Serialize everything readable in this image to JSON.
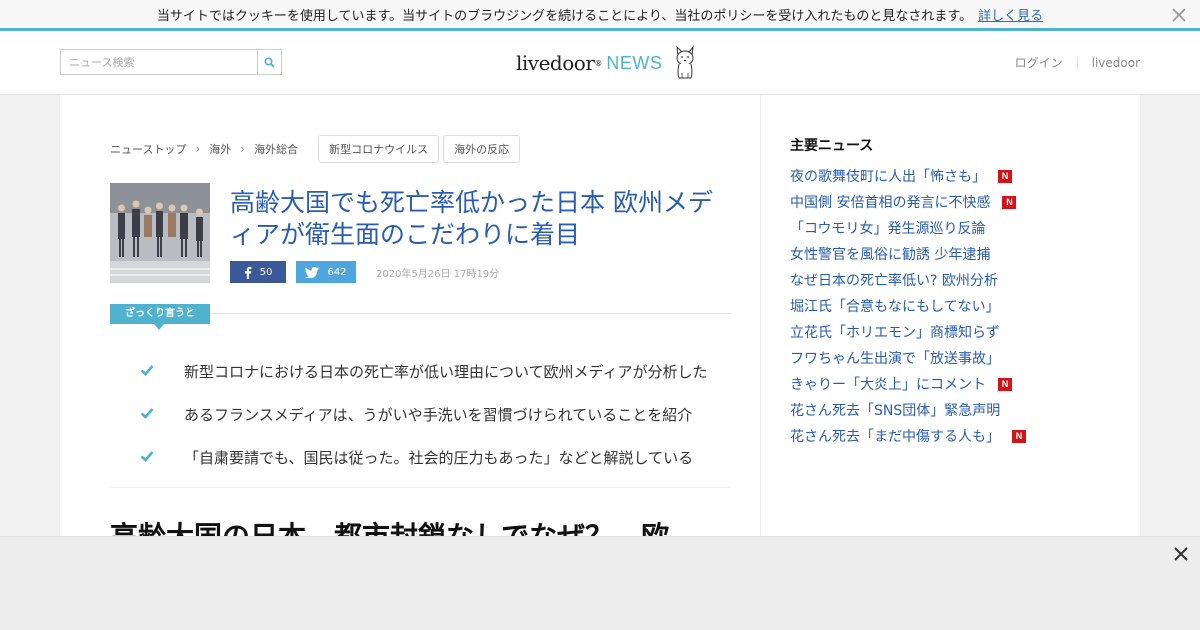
{
  "cookie_bar": {
    "message": "当サイトではクッキーを使用しています。当サイトのブラウジングを続けることにより、当社のポリシーを受け入れたものと見なされます。",
    "more_link": "詳しく見る",
    "close_icon": "close-icon"
  },
  "header": {
    "search_placeholder": "ニュース検索",
    "search_icon": "search-icon",
    "logo_main": "livedoor",
    "logo_sup": "®",
    "logo_news": "NEWS",
    "login": "ログイン",
    "livedoor_link": "livedoor"
  },
  "breadcrumb": {
    "items": [
      "ニューストップ",
      "海外",
      "海外総合"
    ],
    "tags": [
      "新型コロナウイルス",
      "海外の反応"
    ]
  },
  "article": {
    "title": "高齢大国でも死亡率低かった日本 欧州メディアが衛生面のこだわりに着目",
    "facebook_count": "50",
    "twitter_count": "642",
    "date": "2020年5月26日 17時19分",
    "summary_label": "ざっくり言うと",
    "summary_points": [
      "新型コロナにおける日本の死亡率が低い理由について欧州メディアが分析した",
      "あるフランスメディアは、うがいや手洗いを習慣づけられていることを紹介",
      "「自粛要請でも、国民は従った。社会的圧力もあった」などと解説している"
    ],
    "subheading": "高齢大国の日本、都市封鎖なしでなぜ？　欧"
  },
  "sidebar": {
    "title": "主要ニュース",
    "items": [
      {
        "label": "夜の歌舞伎町に人出「怖さも」",
        "new": true
      },
      {
        "label": "中国側 安倍首相の発言に不快感",
        "new": true
      },
      {
        "label": "「コウモリ女」発生源巡り反論",
        "new": false
      },
      {
        "label": "女性警官を風俗に勧誘 少年逮捕",
        "new": false
      },
      {
        "label": "なぜ日本の死亡率低い? 欧州分析",
        "new": false
      },
      {
        "label": "堀江氏「合意もなにもしてない」",
        "new": false
      },
      {
        "label": "立花氏「ホリエモン」商標知らず",
        "new": false
      },
      {
        "label": "フワちゃん生出演で「放送事故」",
        "new": false
      },
      {
        "label": "きゃりー「大炎上」にコメント",
        "new": true
      },
      {
        "label": "花さん死去「SNS団体」緊急声明",
        "new": false
      },
      {
        "label": "花さん死去「まだ中傷する人も」",
        "new": true
      }
    ],
    "new_badge": "N"
  },
  "colors": {
    "accent": "#4fb3cf",
    "link": "#2a5db0",
    "facebook": "#3b5998",
    "twitter": "#4da7de",
    "new_badge": "#d2141a"
  }
}
